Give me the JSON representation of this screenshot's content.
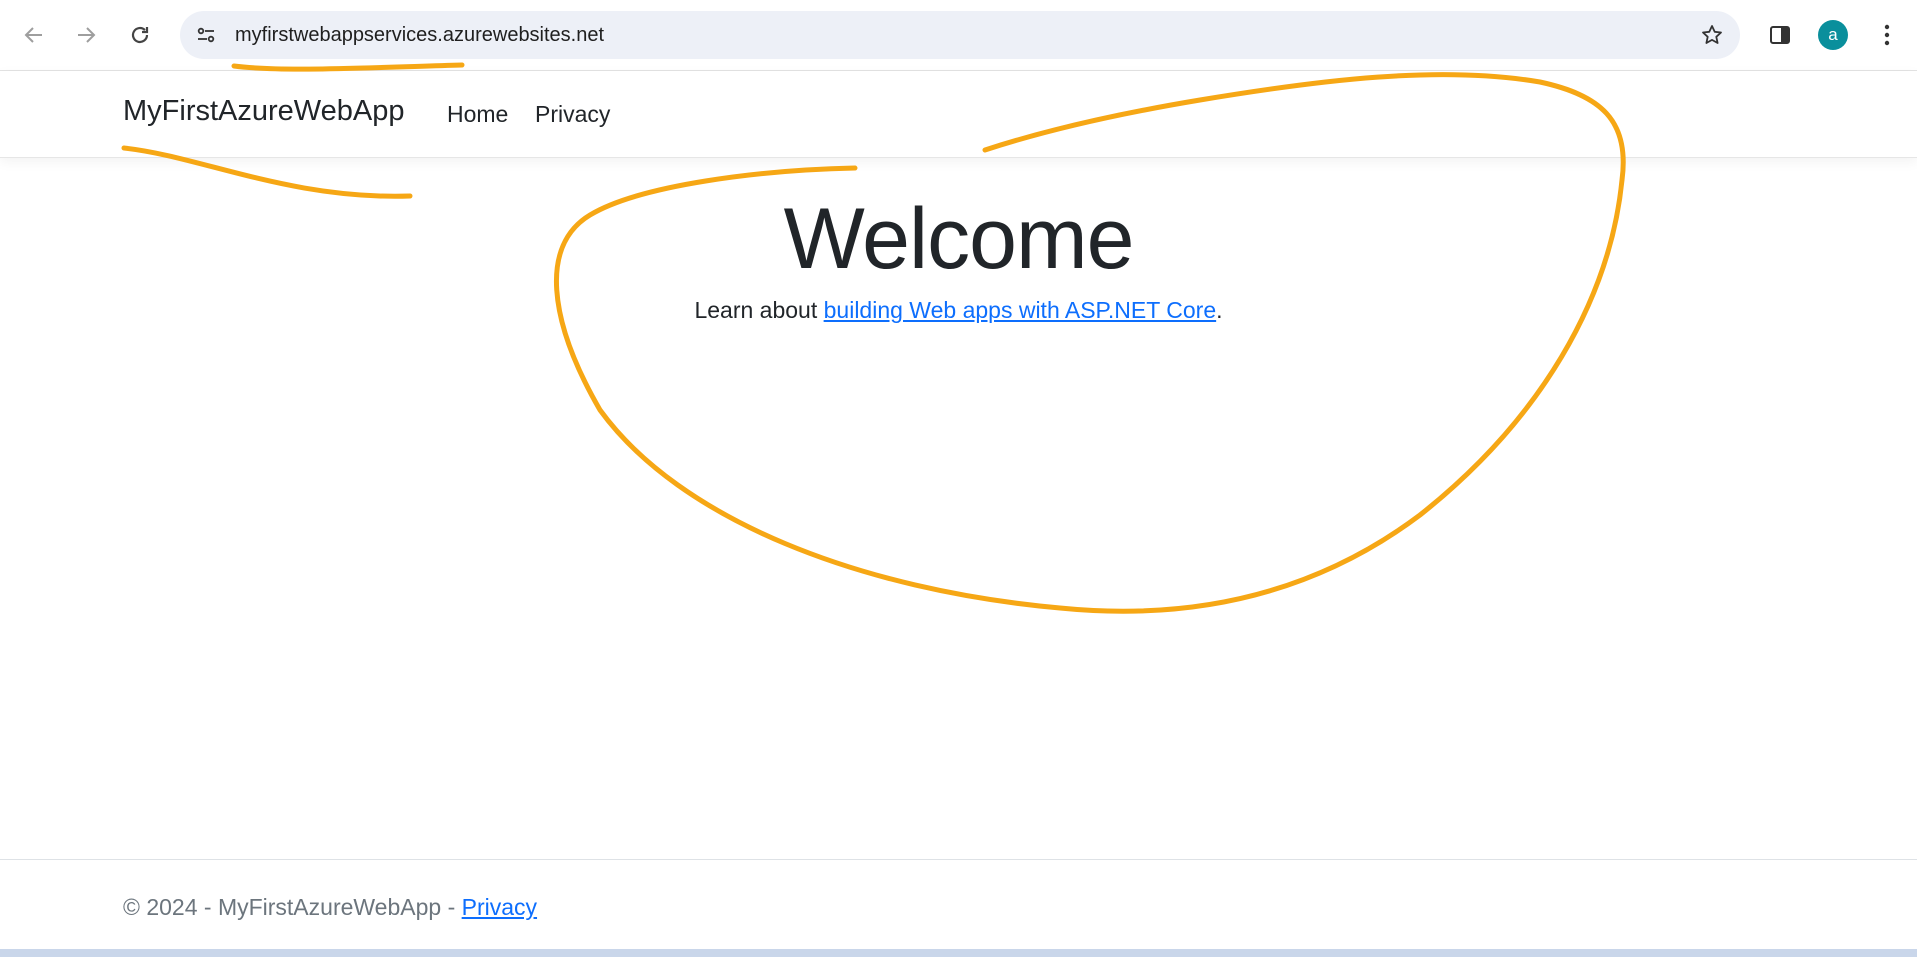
{
  "browser": {
    "url": "myfirstwebappservices.azurewebsites.net",
    "profile_initial": "a",
    "icons": {
      "back": "arrow-left-icon",
      "forward": "arrow-right-icon",
      "reload": "reload-icon",
      "site_info": "tune-icon",
      "bookmark": "star-icon",
      "side_panel": "side-panel-icon",
      "menu": "kebab-menu-icon"
    }
  },
  "navbar": {
    "brand": "MyFirstAzureWebApp",
    "links": [
      "Home",
      "Privacy"
    ]
  },
  "main": {
    "title": "Welcome",
    "text_before": "Learn about ",
    "link_text": "building Web apps with ASP.NET Core",
    "text_after": "."
  },
  "footer": {
    "copyright": "© 2024 - MyFirstAzureWebApp - ",
    "privacy_link": "Privacy"
  },
  "colors": {
    "annotation": "#f6a715",
    "link": "#0d6efd",
    "avatar": "#0a8f9c",
    "omnibox": "#edf0f7"
  }
}
